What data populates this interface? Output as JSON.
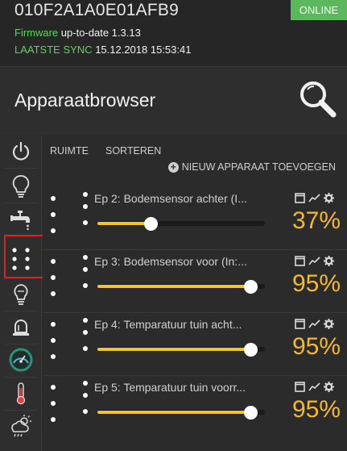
{
  "header": {
    "device_id": "010F2A1A0E01AFB9",
    "status": "ONLINE",
    "firmware_label": "Firmware",
    "firmware_value": "up-to-date 1.3.13",
    "sync_label": "LAATSTE SYNC",
    "sync_value": "15.12.2018 15:53:41"
  },
  "title_bar": {
    "title": "Apparaatbrowser"
  },
  "toolbar": {
    "room_label": "RUIMTE",
    "sort_label": "SORTEREN",
    "add_device_label": "NIEUW APPARAAT TOEVOEGEN"
  },
  "sidebar": {
    "items": [
      {
        "icon": "power-icon"
      },
      {
        "icon": "lightbulb-icon"
      },
      {
        "icon": "faucet-icon"
      },
      {
        "icon": "dots-grid-icon",
        "selected": true
      },
      {
        "icon": "dimmer-bulb-icon"
      },
      {
        "icon": "alarm-light-icon"
      },
      {
        "icon": "gauge-icon"
      },
      {
        "icon": "thermometer-icon"
      },
      {
        "icon": "weather-icon"
      }
    ]
  },
  "devices": [
    {
      "name": "Ep 2: Bodemsensor achter (I...",
      "value": "37%",
      "level": 0.37
    },
    {
      "name": "Ep 3: Bodemsensor voor (In:...",
      "value": "95%",
      "level": 0.95
    },
    {
      "name": "Ep 4: Temparatuur tuin acht...",
      "value": "95%",
      "level": 0.95
    },
    {
      "name": "Ep 5: Temparatuur tuin voorr...",
      "value": "95%",
      "level": 0.95
    }
  ],
  "colors": {
    "online": "#5cb85c",
    "label_green": "#5fd35f",
    "value_yellow": "#f5b92a",
    "slider_fill": "#f5c518",
    "selection_red": "#e02020"
  }
}
